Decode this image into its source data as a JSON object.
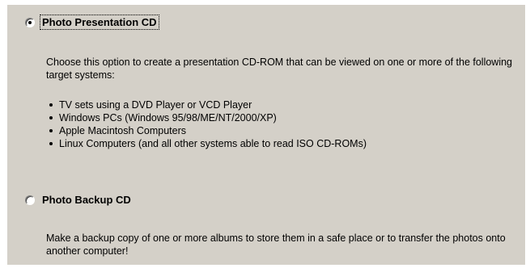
{
  "options": [
    {
      "label": "Photo Presentation CD",
      "selected": true,
      "description": "Choose this option to create a presentation CD-ROM that can be viewed on one or more of the following target systems:",
      "bullets": [
        "TV sets using a DVD Player or VCD Player",
        "Windows PCs (Windows 95/98/ME/NT/2000/XP)",
        "Apple Macintosh Computers",
        "Linux Computers (and all other systems able to read ISO CD-ROMs)"
      ]
    },
    {
      "label": "Photo Backup CD",
      "selected": false,
      "description": "Make a backup copy of one or more albums to store them in a safe place or to transfer the photos onto another computer!"
    }
  ]
}
